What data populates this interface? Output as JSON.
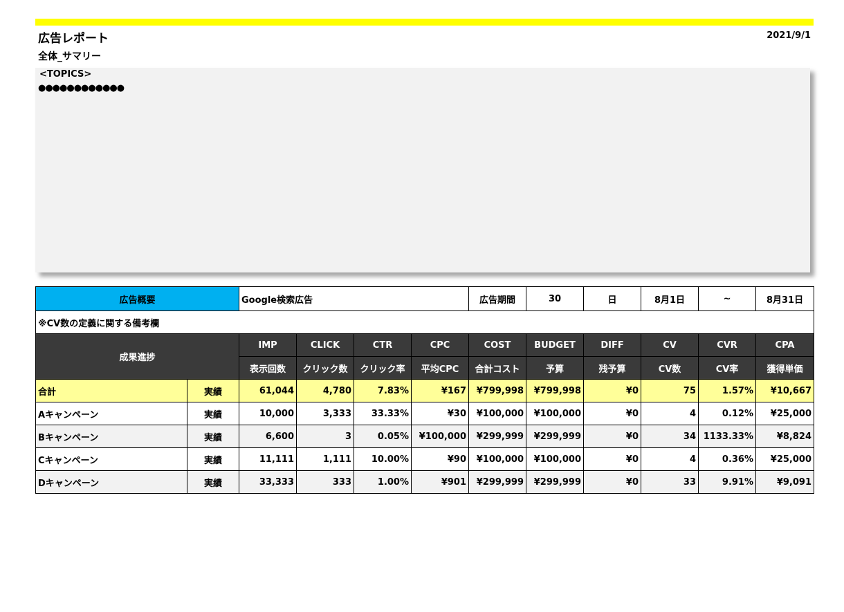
{
  "header": {
    "title": "広告レポート",
    "date": "2021/9/1",
    "subtitle": "全体_サマリー"
  },
  "topics": {
    "label": "<TOPICS>",
    "body": "●●●●●●●●●●●●"
  },
  "overview": {
    "label": "広告概要",
    "ad_type": "Google検索広告",
    "period_label": "広告期間",
    "days": "30",
    "days_unit": "日",
    "start": "8月1日",
    "tilde": "~",
    "end": "8月31日"
  },
  "note": "※CV数の定義に関する備考欄",
  "table": {
    "progress_label": "成果進捗",
    "columns_en": [
      "IMP",
      "CLICK",
      "CTR",
      "CPC",
      "COST",
      "BUDGET",
      "DIFF",
      "CV",
      "CVR",
      "CPA"
    ],
    "columns_ja": [
      "表示回数",
      "クリック数",
      "クリック率",
      "平均CPC",
      "合計コスト",
      "予算",
      "残予算",
      "CV数",
      "CV率",
      "獲得単価"
    ],
    "rows": [
      {
        "name": "合計",
        "kind": "実績",
        "values": [
          "61,044",
          "4,780",
          "7.83%",
          "¥167",
          "¥799,998",
          "¥799,998",
          "¥0",
          "75",
          "1.57%",
          "¥10,667"
        ]
      },
      {
        "name": "Aキャンペーン",
        "kind": "実績",
        "values": [
          "10,000",
          "3,333",
          "33.33%",
          "¥30",
          "¥100,000",
          "¥100,000",
          "¥0",
          "4",
          "0.12%",
          "¥25,000"
        ]
      },
      {
        "name": "Bキャンペーン",
        "kind": "実績",
        "values": [
          "6,600",
          "3",
          "0.05%",
          "¥100,000",
          "¥299,999",
          "¥299,999",
          "¥0",
          "34",
          "1133.33%",
          "¥8,824"
        ]
      },
      {
        "name": "Cキャンペーン",
        "kind": "実績",
        "values": [
          "11,111",
          "1,111",
          "10.00%",
          "¥90",
          "¥100,000",
          "¥100,000",
          "¥0",
          "4",
          "0.36%",
          "¥25,000"
        ]
      },
      {
        "name": "Dキャンペーン",
        "kind": "実績",
        "values": [
          "33,333",
          "333",
          "1.00%",
          "¥901",
          "¥299,999",
          "¥299,999",
          "¥0",
          "33",
          "9.91%",
          "¥9,091"
        ]
      }
    ]
  },
  "colors": {
    "top_bar": "#ffff00",
    "overview_label_bg": "#00b0f0",
    "header_bg": "#3a3a3a",
    "total_row_bg": "#ffff99",
    "alt_row_bg": "#f2f2f2"
  }
}
